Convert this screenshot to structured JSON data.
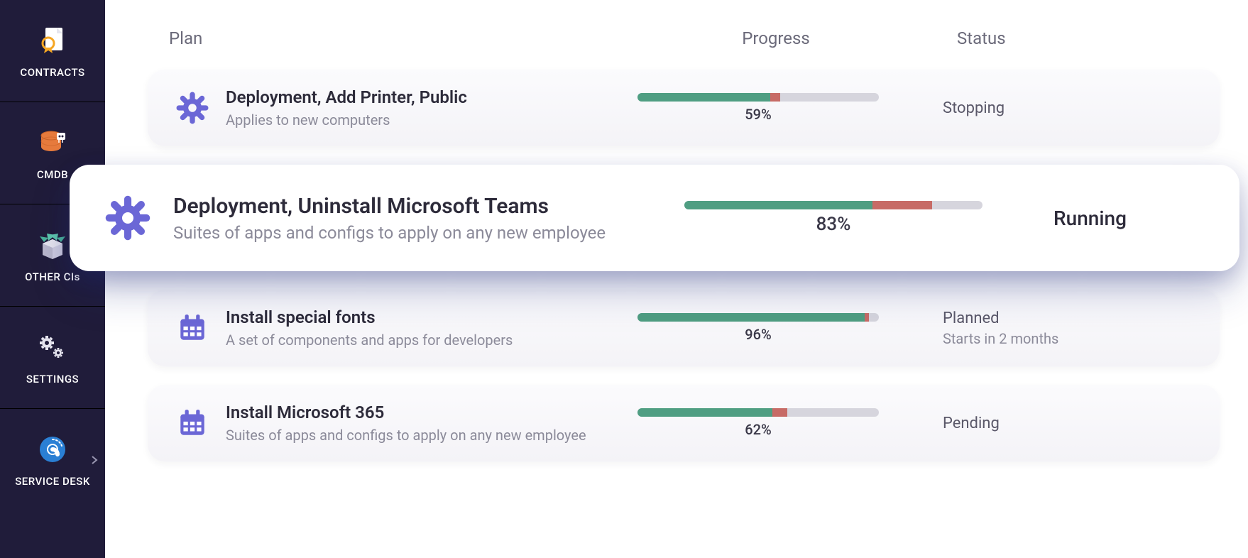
{
  "sidebar": {
    "items": [
      {
        "label": "CONTRACTS"
      },
      {
        "label": "CMDB"
      },
      {
        "label": "OTHER CIs"
      },
      {
        "label": "SETTINGS"
      },
      {
        "label": "SERVICE DESK"
      }
    ]
  },
  "headers": {
    "plan": "Plan",
    "progress": "Progress",
    "status": "Status"
  },
  "rows": [
    {
      "icon": "gear",
      "title": "Deployment, Add Printer, Public",
      "subtitle": "Applies to new computers",
      "progress_green": 55,
      "progress_red": 4,
      "progress_label": "59%",
      "status": "Stopping",
      "status_sub": "",
      "highlight": false
    },
    {
      "icon": "gear",
      "title": "Deployment, Uninstall Microsoft Teams",
      "subtitle": "Suites of apps and configs to apply on any new employee",
      "progress_green": 63,
      "progress_red": 20,
      "progress_label": "83%",
      "status": "Running",
      "status_sub": "",
      "highlight": true
    },
    {
      "icon": "calendar",
      "title": "Install special fonts",
      "subtitle": "A set of components and apps for developers",
      "progress_green": 94,
      "progress_red": 2,
      "progress_label": "96%",
      "status": "Planned",
      "status_sub": "Starts in 2 months",
      "highlight": false
    },
    {
      "icon": "calendar",
      "title": "Install Microsoft 365",
      "subtitle": "Suites of apps and configs to apply on any new employee",
      "progress_green": 56,
      "progress_red": 6,
      "progress_label": "62%",
      "status": "Pending",
      "status_sub": "",
      "highlight": false
    }
  ]
}
